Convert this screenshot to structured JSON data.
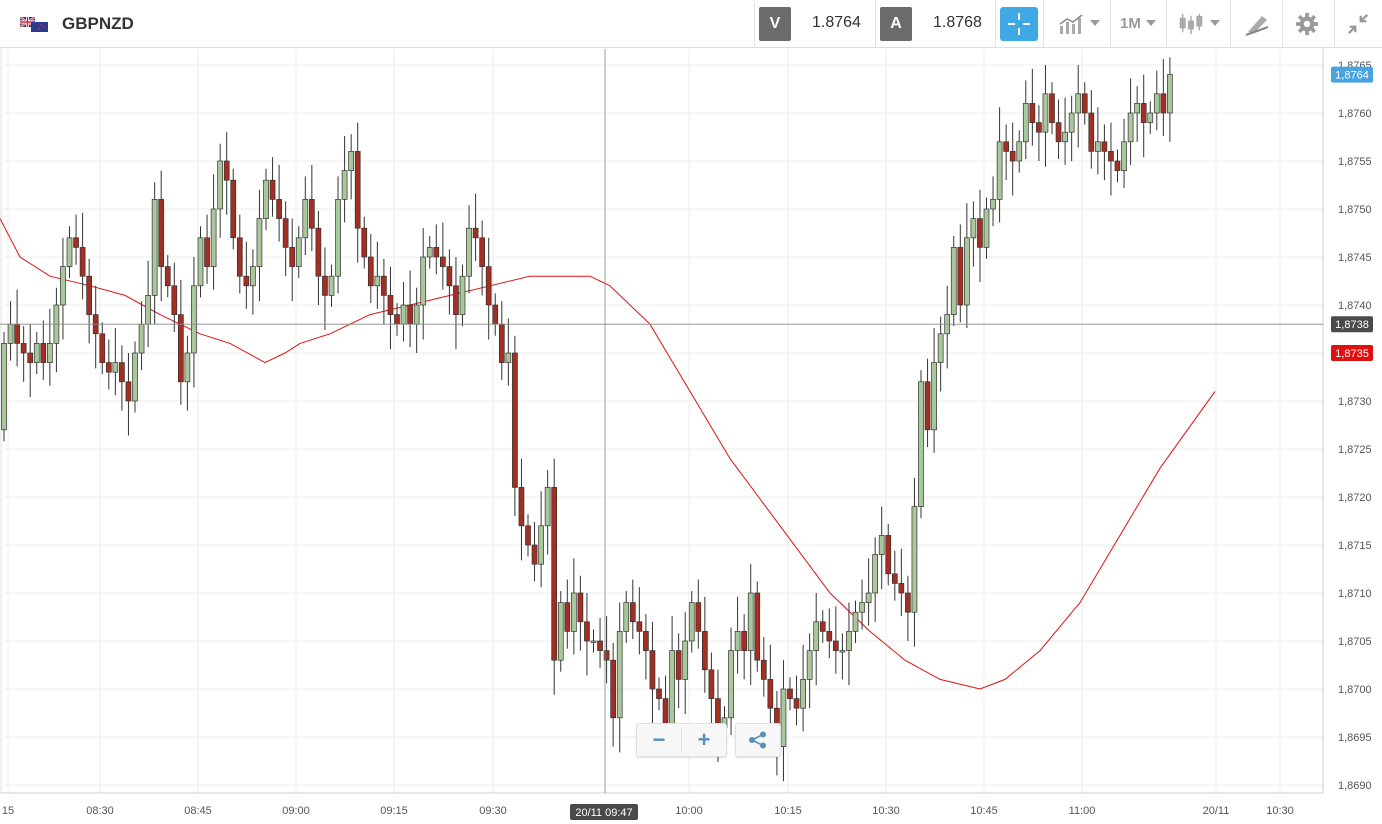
{
  "toolbar": {
    "symbol": "GBPNZD",
    "sell_label": "V",
    "sell_price": "1.8764",
    "buy_label": "A",
    "buy_price": "1.8768",
    "timeframe": "1M",
    "accent_color": "#3fa9e6",
    "icons": [
      "uk-nz-flag-icon",
      "crosshair-icon",
      "chart-type-icon",
      "candlestick-icon",
      "draw-tools-icon",
      "gear-icon",
      "collapse-icon"
    ]
  },
  "chart_data": {
    "type": "candlestick",
    "symbol": "GBPNZD",
    "ylim": [
      1.869,
      1.8766
    ],
    "y_ticks": [
      "1,8765",
      "1,8760",
      "1,8755",
      "1,8750",
      "1,8745",
      "1,8740",
      "1,8735",
      "1,8730",
      "1,8725",
      "1,8720",
      "1,8715",
      "1,8710",
      "1,8705",
      "1,8700",
      "1,8695",
      "1,8690"
    ],
    "x_ticks": [
      "15",
      "08:30",
      "08:45",
      "09:00",
      "09:15",
      "09:30",
      "10:00",
      "10:15",
      "10:30",
      "10:45",
      "11:00",
      "20/11",
      "10:30"
    ],
    "crosshair_time_label": "20/11 09:47",
    "crosshair_price_label": "1,8738",
    "last_price_label": "1,8764",
    "last_price_color": "#4aa3df",
    "ma_label": "1,8735",
    "ma_color": "#e01010",
    "grid": true,
    "up_color": "#a8c79a",
    "down_color": "#a32e22",
    "candles": [
      [
        1.8727,
        1.8736
      ],
      [
        1.8736,
        1.8738
      ],
      [
        1.8738,
        1.8736
      ],
      [
        1.8736,
        1.8735
      ],
      [
        1.8735,
        1.8734
      ],
      [
        1.8734,
        1.8736
      ],
      [
        1.8736,
        1.8734
      ],
      [
        1.8734,
        1.8736
      ],
      [
        1.8736,
        1.874
      ],
      [
        1.874,
        1.8744
      ],
      [
        1.8744,
        1.8747
      ],
      [
        1.8747,
        1.8746
      ],
      [
        1.8746,
        1.8743
      ],
      [
        1.8743,
        1.8739
      ],
      [
        1.8739,
        1.8737
      ],
      [
        1.8737,
        1.8734
      ],
      [
        1.8734,
        1.8733
      ],
      [
        1.8733,
        1.8734
      ],
      [
        1.8734,
        1.8732
      ],
      [
        1.8732,
        1.873
      ],
      [
        1.873,
        1.8735
      ],
      [
        1.8735,
        1.8738
      ],
      [
        1.8738,
        1.8741
      ],
      [
        1.8741,
        1.8751
      ],
      [
        1.8751,
        1.8744
      ],
      [
        1.8744,
        1.8742
      ],
      [
        1.8742,
        1.8739
      ],
      [
        1.8739,
        1.8732
      ],
      [
        1.8732,
        1.8735
      ],
      [
        1.8735,
        1.8742
      ],
      [
        1.8742,
        1.8747
      ],
      [
        1.8747,
        1.8744
      ],
      [
        1.8744,
        1.875
      ],
      [
        1.875,
        1.8755
      ],
      [
        1.8755,
        1.8753
      ],
      [
        1.8753,
        1.8747
      ],
      [
        1.8747,
        1.8743
      ],
      [
        1.8743,
        1.8742
      ],
      [
        1.8742,
        1.8744
      ],
      [
        1.8744,
        1.8749
      ],
      [
        1.8749,
        1.8753
      ],
      [
        1.8753,
        1.8751
      ],
      [
        1.8751,
        1.8749
      ],
      [
        1.8749,
        1.8746
      ],
      [
        1.8746,
        1.8744
      ],
      [
        1.8744,
        1.8747
      ],
      [
        1.8747,
        1.8751
      ],
      [
        1.8751,
        1.8748
      ],
      [
        1.8748,
        1.8743
      ],
      [
        1.8743,
        1.8741
      ],
      [
        1.8741,
        1.8743
      ],
      [
        1.8743,
        1.8751
      ],
      [
        1.8751,
        1.8754
      ],
      [
        1.8754,
        1.8756
      ],
      [
        1.8756,
        1.8748
      ],
      [
        1.8748,
        1.8745
      ],
      [
        1.8745,
        1.8742
      ],
      [
        1.8742,
        1.8743
      ],
      [
        1.8743,
        1.8741
      ],
      [
        1.8741,
        1.8739
      ],
      [
        1.8739,
        1.8738
      ],
      [
        1.8738,
        1.874
      ],
      [
        1.874,
        1.8738
      ],
      [
        1.8738,
        1.874
      ],
      [
        1.874,
        1.8745
      ],
      [
        1.8745,
        1.8746
      ],
      [
        1.8746,
        1.8745
      ],
      [
        1.8745,
        1.8744
      ],
      [
        1.8744,
        1.8742
      ],
      [
        1.8742,
        1.8739
      ],
      [
        1.8739,
        1.8743
      ],
      [
        1.8743,
        1.8748
      ],
      [
        1.8748,
        1.8747
      ],
      [
        1.8747,
        1.8744
      ],
      [
        1.8744,
        1.874
      ],
      [
        1.874,
        1.8738
      ],
      [
        1.8738,
        1.8734
      ],
      [
        1.8734,
        1.8735
      ],
      [
        1.8735,
        1.8721
      ],
      [
        1.8721,
        1.8717
      ],
      [
        1.8717,
        1.8715
      ],
      [
        1.8715,
        1.8713
      ],
      [
        1.8713,
        1.8717
      ],
      [
        1.8717,
        1.8721
      ],
      [
        1.8721,
        1.8703
      ],
      [
        1.8703,
        1.8709
      ],
      [
        1.8709,
        1.8706
      ],
      [
        1.8706,
        1.871
      ],
      [
        1.871,
        1.8707
      ],
      [
        1.8707,
        1.8705
      ],
      [
        1.8705,
        1.8705
      ],
      [
        1.8705,
        1.8704
      ],
      [
        1.8704,
        1.8703
      ],
      [
        1.8703,
        1.8697
      ],
      [
        1.8697,
        1.8706
      ],
      [
        1.8706,
        1.8709
      ],
      [
        1.8709,
        1.8707
      ],
      [
        1.8707,
        1.8706
      ],
      [
        1.8706,
        1.8704
      ],
      [
        1.8704,
        1.87
      ],
      [
        1.87,
        1.8699
      ],
      [
        1.8699,
        1.8696
      ],
      [
        1.8696,
        1.8704
      ],
      [
        1.8704,
        1.8701
      ],
      [
        1.8701,
        1.8705
      ],
      [
        1.8705,
        1.8709
      ],
      [
        1.8709,
        1.8706
      ],
      [
        1.8706,
        1.8702
      ],
      [
        1.8702,
        1.8699
      ],
      [
        1.8699,
        1.8696
      ],
      [
        1.8696,
        1.8697
      ],
      [
        1.8697,
        1.8704
      ],
      [
        1.8704,
        1.8706
      ],
      [
        1.8706,
        1.8704
      ],
      [
        1.8704,
        1.871
      ],
      [
        1.871,
        1.8703
      ],
      [
        1.8703,
        1.8701
      ],
      [
        1.8701,
        1.8698
      ],
      [
        1.8698,
        1.8694
      ],
      [
        1.8694,
        1.87
      ],
      [
        1.87,
        1.8699
      ],
      [
        1.8699,
        1.8698
      ],
      [
        1.8698,
        1.8701
      ],
      [
        1.8701,
        1.8704
      ],
      [
        1.8704,
        1.8707
      ],
      [
        1.8707,
        1.8706
      ],
      [
        1.8706,
        1.8705
      ],
      [
        1.8705,
        1.8704
      ],
      [
        1.8704,
        1.8704
      ],
      [
        1.8704,
        1.8706
      ],
      [
        1.8706,
        1.8708
      ],
      [
        1.8708,
        1.8709
      ],
      [
        1.8709,
        1.871
      ],
      [
        1.871,
        1.8714
      ],
      [
        1.8714,
        1.8716
      ],
      [
        1.8716,
        1.8712
      ],
      [
        1.8712,
        1.8711
      ],
      [
        1.8711,
        1.871
      ],
      [
        1.871,
        1.8708
      ],
      [
        1.8708,
        1.8719
      ],
      [
        1.8719,
        1.8732
      ],
      [
        1.8732,
        1.8727
      ],
      [
        1.8727,
        1.8734
      ],
      [
        1.8734,
        1.8737
      ],
      [
        1.8737,
        1.8739
      ],
      [
        1.8739,
        1.8746
      ],
      [
        1.8746,
        1.874
      ],
      [
        1.874,
        1.8747
      ],
      [
        1.8747,
        1.8749
      ],
      [
        1.8749,
        1.8746
      ],
      [
        1.8746,
        1.875
      ],
      [
        1.875,
        1.8751
      ],
      [
        1.8751,
        1.8757
      ],
      [
        1.8757,
        1.8756
      ],
      [
        1.8756,
        1.8755
      ],
      [
        1.8755,
        1.8757
      ],
      [
        1.8757,
        1.8761
      ],
      [
        1.8761,
        1.8759
      ],
      [
        1.8759,
        1.8758
      ],
      [
        1.8758,
        1.8762
      ],
      [
        1.8762,
        1.8759
      ],
      [
        1.8759,
        1.8757
      ],
      [
        1.8757,
        1.8758
      ],
      [
        1.8758,
        1.876
      ],
      [
        1.876,
        1.8762
      ],
      [
        1.8762,
        1.876
      ],
      [
        1.876,
        1.8756
      ],
      [
        1.8756,
        1.8757
      ],
      [
        1.8757,
        1.8756
      ],
      [
        1.8756,
        1.8755
      ],
      [
        1.8755,
        1.8754
      ],
      [
        1.8754,
        1.8757
      ],
      [
        1.8757,
        1.876
      ],
      [
        1.876,
        1.8761
      ],
      [
        1.8761,
        1.8759
      ],
      [
        1.8759,
        1.876
      ],
      [
        1.876,
        1.8762
      ],
      [
        1.8762,
        1.876
      ],
      [
        1.876,
        1.8764
      ]
    ],
    "ma": [
      [
        0,
        1.8749
      ],
      [
        20,
        1.8745
      ],
      [
        50,
        1.8743
      ],
      [
        90,
        1.8742
      ],
      [
        125,
        1.8741
      ],
      [
        160,
        1.8739
      ],
      [
        200,
        1.8737
      ],
      [
        230,
        1.8736
      ],
      [
        265,
        1.8734
      ],
      [
        285,
        1.8735
      ],
      [
        300,
        1.8736
      ],
      [
        330,
        1.8737
      ],
      [
        370,
        1.8739
      ],
      [
        410,
        1.874
      ],
      [
        450,
        1.8741
      ],
      [
        490,
        1.8742
      ],
      [
        530,
        1.8743
      ],
      [
        560,
        1.8743
      ],
      [
        590,
        1.8743
      ],
      [
        610,
        1.8742
      ],
      [
        650,
        1.8738
      ],
      [
        690,
        1.8731
      ],
      [
        730,
        1.8724
      ],
      [
        780,
        1.8717
      ],
      [
        830,
        1.871
      ],
      [
        870,
        1.8706
      ],
      [
        905,
        1.8703
      ],
      [
        940,
        1.8701
      ],
      [
        980,
        1.87
      ],
      [
        1005,
        1.8701
      ],
      [
        1040,
        1.8704
      ],
      [
        1080,
        1.8709
      ],
      [
        1120,
        1.8716
      ],
      [
        1160,
        1.8723
      ],
      [
        1215,
        1.8731
      ]
    ]
  },
  "zoom": {
    "minus": "−",
    "plus": "+"
  }
}
